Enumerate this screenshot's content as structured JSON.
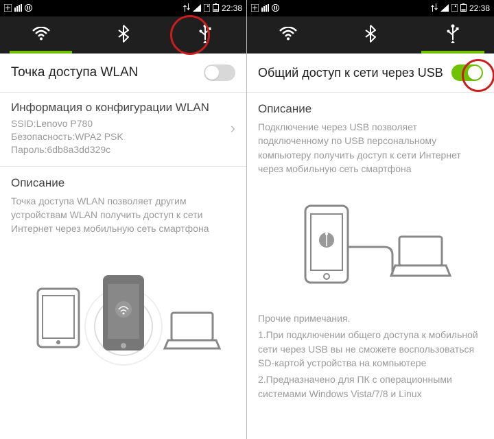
{
  "left": {
    "status": {
      "time": "22:38"
    },
    "header": {
      "title": "Точка доступа WLAN",
      "toggle_on": false
    },
    "config": {
      "title": "Информация о конфигурации WLAN",
      "ssid": "SSID:Lenovo P780",
      "security": "Безопасность:WPA2 PSK",
      "password": "Пароль:6db8a3dd329c"
    },
    "desc": {
      "title": "Описание",
      "body": "Точка доступа WLAN позволяет другим устройствам WLAN получить доступ к сети Интернет через мобильную сеть смартфона"
    }
  },
  "right": {
    "status": {
      "time": "22:38"
    },
    "header": {
      "title": "Общий доступ к сети через USB",
      "toggle_on": true
    },
    "desc": {
      "title": "Описание",
      "body": "Подключение через USB позволяет подключенному по USB персональному компьютеру получить доступ к сети Интернет через мобильную сеть смартфона"
    },
    "notes": {
      "title": "Прочие примечания.",
      "l1": "1.При подключении общего доступа к мобильной сети через USB вы не сможете воспользоваться SD-картой устройства на компьютере",
      "l2": "2.Предназначено для ПК с операционными системами Windows Vista/7/8 и Linux"
    }
  }
}
